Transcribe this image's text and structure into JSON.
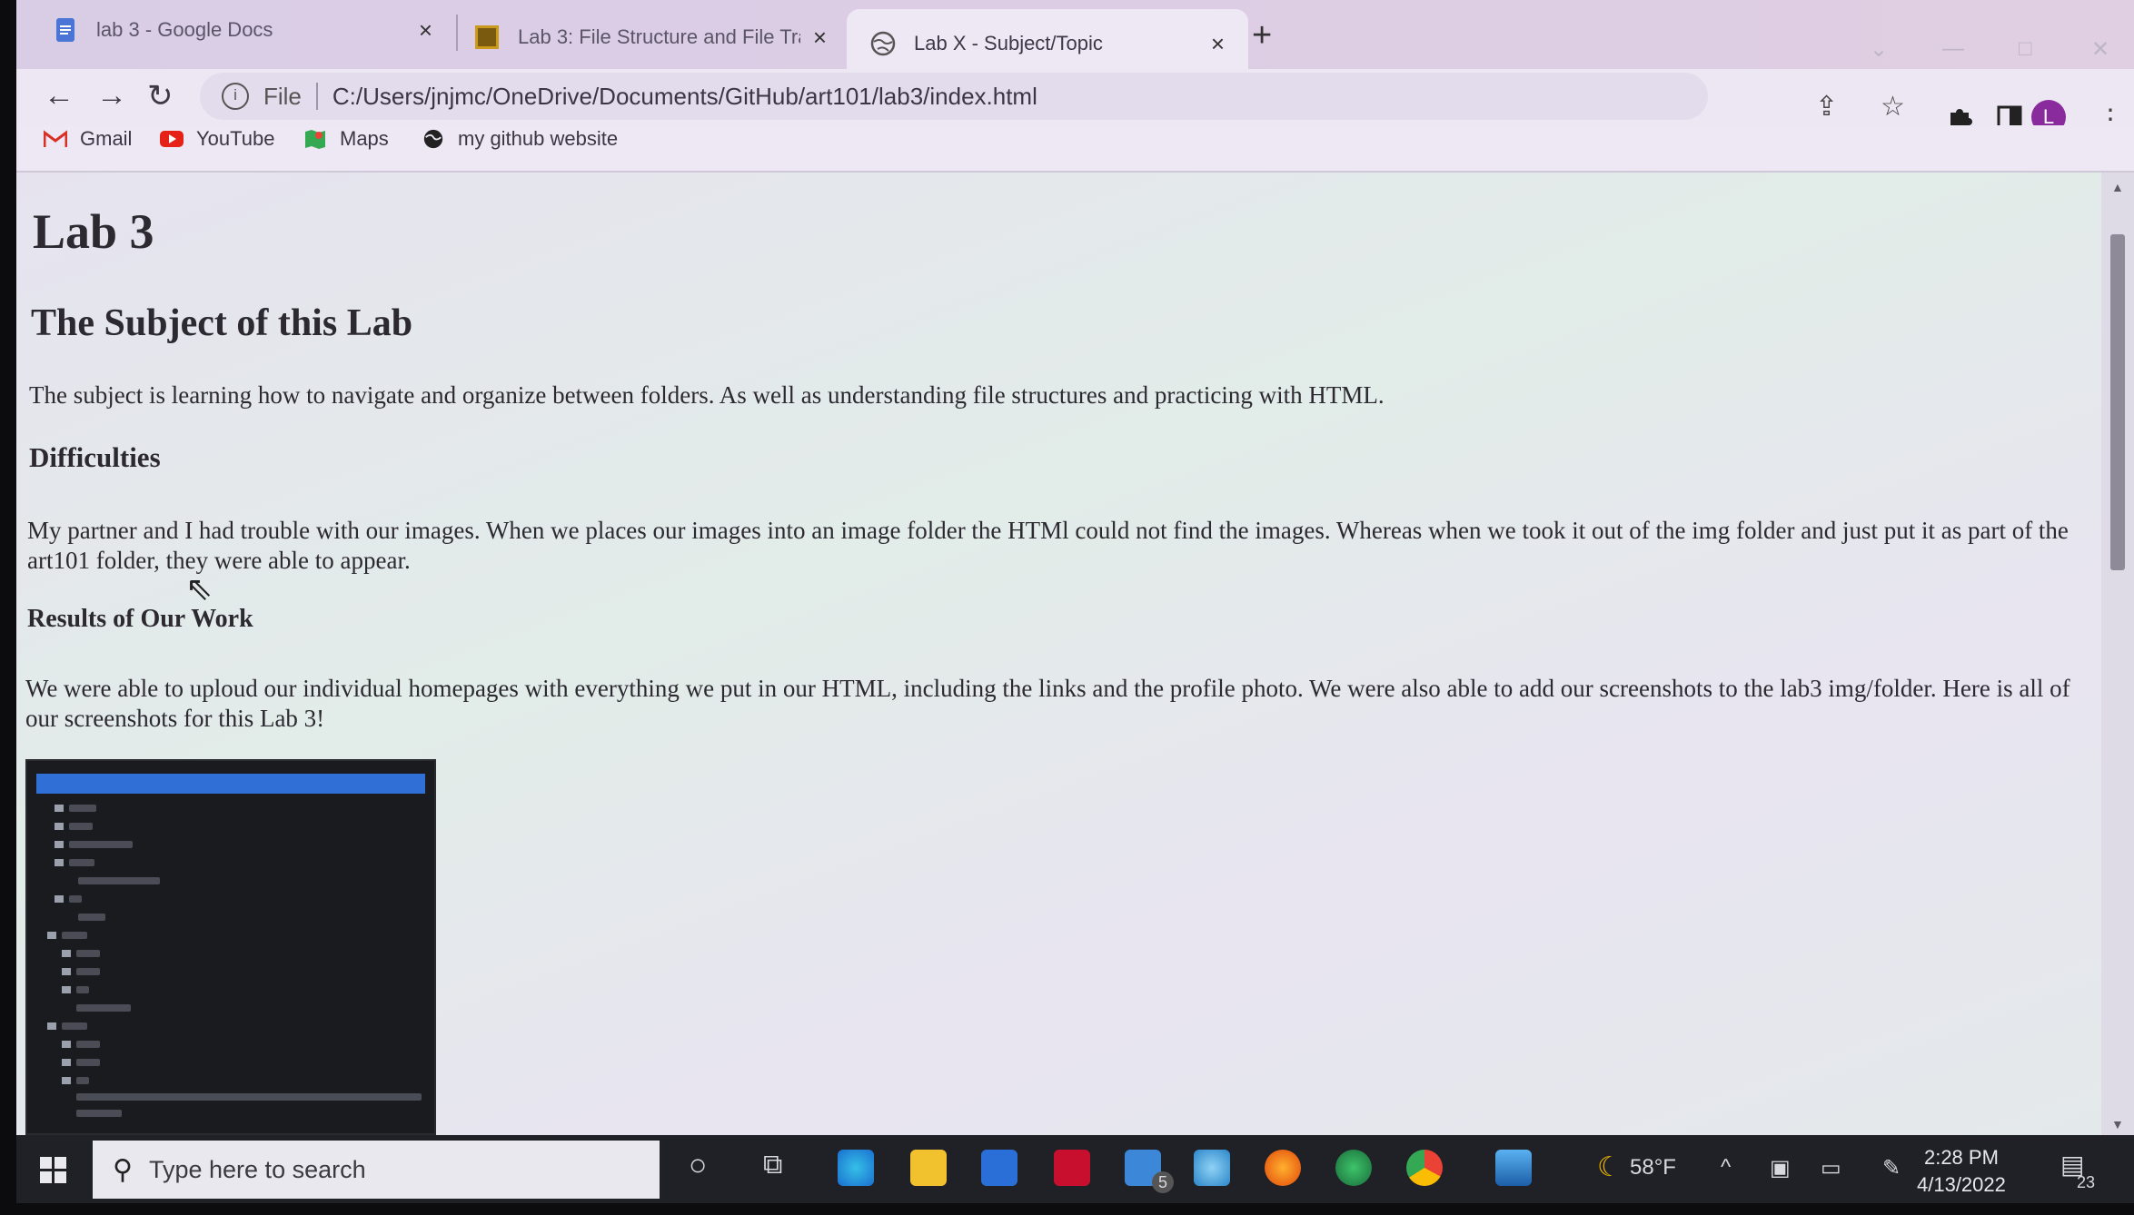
{
  "tabs": [
    {
      "title": "lab 3 - Google Docs",
      "icon": "google-docs-icon",
      "close": "×"
    },
    {
      "title": "Lab 3: File Structure and File Tran",
      "icon": "ucsc-icon",
      "close": "×"
    },
    {
      "title": "Lab X - Subject/Topic",
      "icon": "globe-icon",
      "close": "×"
    }
  ],
  "new_tab": "+",
  "toolbar": {
    "back": "←",
    "forward": "→",
    "reload": "↻",
    "info": "i",
    "scheme_label": "File",
    "url": "C:/Users/jnjmc/OneDrive/Documents/GitHub/art101/lab3/index.html",
    "avatar_letter": "L",
    "menu": "⋮"
  },
  "bookmarks": [
    {
      "label": "Gmail",
      "icon": "gmail-icon"
    },
    {
      "label": "YouTube",
      "icon": "youtube-icon"
    },
    {
      "label": "Maps",
      "icon": "maps-icon"
    },
    {
      "label": "my github website",
      "icon": "globe-icon"
    }
  ],
  "page": {
    "h1": "Lab 3",
    "h2": "The Subject of this Lab",
    "subject_text": "The subject is learning how to navigate and organize between folders. As well as understanding file structures and practicing with HTML.",
    "difficulties_heading": "Difficulties",
    "difficulties_text": "My partner and I had trouble with our images. When we places our images into an image folder the HTMl could not find the images. Whereas when we took it out of the img folder and just put it as part of the art101 folder, they were able to appear.",
    "results_heading": "Results of Our Work",
    "results_text": "We were able to uploud our individual homepages with everything we put in our HTML, including the links and the profile photo. We were also able to add our screenshots to the lab3 img/folder. Here is all of our screenshots for this Lab 3!"
  },
  "taskbar": {
    "search_placeholder": "Type here to search",
    "mail_badge": "5",
    "weather": "58°F",
    "time": "2:28 PM",
    "date": "4/13/2022",
    "notifications": "23"
  },
  "colors": {
    "tab_strip": "#dccde4",
    "page_bg": "#e6e3ef",
    "taskbar": "#1f2126",
    "selection_blue": "#2f6fd6"
  }
}
